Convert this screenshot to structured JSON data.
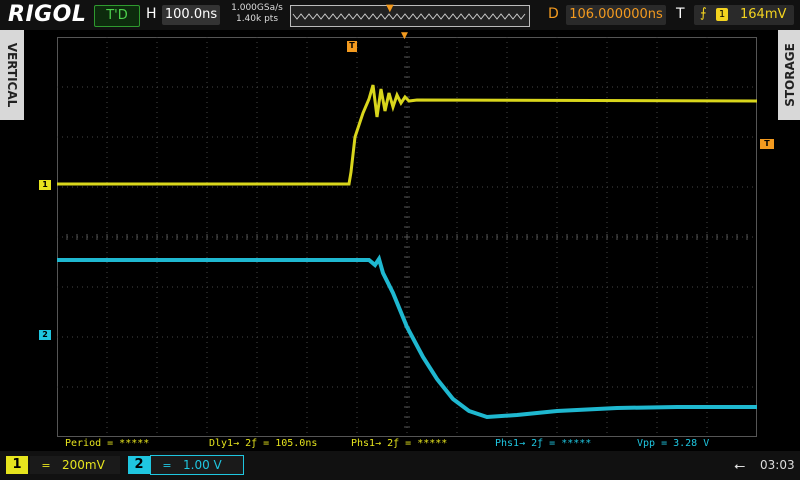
{
  "header": {
    "brand": "RIGOL",
    "trigger_status": "T'D",
    "horizontal_label": "H",
    "timebase": "100.0ns",
    "sample_rate": "1.000GSa/s",
    "memory_depth": "1.40k pts",
    "delay_label": "D",
    "delay": "106.000000ns",
    "trigger_label": "T",
    "trigger_source": "1",
    "trigger_level": "164mV",
    "trigger_edge_icon": "rising-edge-icon"
  },
  "side_tabs": {
    "left": "VERTICAL",
    "right": "STORAGE"
  },
  "markers": {
    "ch1": "1",
    "ch2": "2",
    "trigger": "T"
  },
  "measurements": {
    "period": "Period = *****",
    "delay": "Dly1→ 2ƒ  = 105.0ns",
    "phase_rise": "Phs1→ 2ƒ  = *****",
    "phase_fall": "Phs1→ 2ƒ  = *****",
    "vpp": "Vpp = 3.28 V"
  },
  "channels": [
    {
      "number": "1",
      "coupling": "=",
      "scale": "200mV",
      "color": "#e6e41e"
    },
    {
      "number": "2",
      "coupling": "=",
      "scale": "1.00 V",
      "color": "#1fc6e0"
    }
  ],
  "status": {
    "time": "03:03",
    "usb_icon": "usb-icon"
  }
}
